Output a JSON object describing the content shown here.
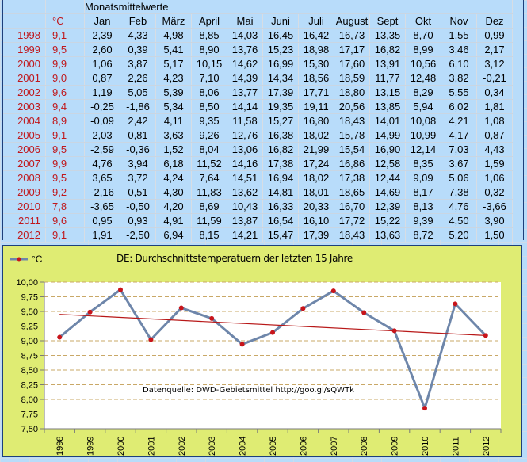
{
  "table": {
    "section_title": "Monatsmittelwerte",
    "headers": [
      "°C",
      "Jan",
      "Feb",
      "März",
      "April",
      "Mai",
      "Juni",
      "Juli",
      "August",
      "Sept",
      "Okt",
      "Nov",
      "Dez"
    ],
    "rows": [
      {
        "year": "1998",
        "avg": "9,1",
        "months": [
          "2,39",
          "4,33",
          "4,98",
          "8,85",
          "14,03",
          "16,45",
          "16,42",
          "16,73",
          "13,35",
          "8,70",
          "1,55",
          "0,99"
        ]
      },
      {
        "year": "1999",
        "avg": "9,5",
        "months": [
          "2,60",
          "0,39",
          "5,41",
          "8,90",
          "13,76",
          "15,23",
          "18,98",
          "17,17",
          "16,82",
          "8,99",
          "3,46",
          "2,17"
        ]
      },
      {
        "year": "2000",
        "avg": "9,9",
        "months": [
          "1,06",
          "3,87",
          "5,17",
          "10,15",
          "14,62",
          "16,99",
          "15,30",
          "17,60",
          "13,91",
          "10,56",
          "6,10",
          "3,12"
        ]
      },
      {
        "year": "2001",
        "avg": "9,0",
        "months": [
          "0,87",
          "2,26",
          "4,23",
          "7,10",
          "14,39",
          "14,34",
          "18,56",
          "18,59",
          "11,77",
          "12,48",
          "3,82",
          "-0,21"
        ]
      },
      {
        "year": "2002",
        "avg": "9,6",
        "months": [
          "1,19",
          "5,05",
          "5,39",
          "8,06",
          "13,77",
          "17,39",
          "17,71",
          "18,80",
          "13,15",
          "8,29",
          "5,55",
          "0,34"
        ]
      },
      {
        "year": "2003",
        "avg": "9,4",
        "months": [
          "-0,25",
          "-1,86",
          "5,34",
          "8,50",
          "14,14",
          "19,35",
          "19,11",
          "20,56",
          "13,85",
          "5,94",
          "6,02",
          "1,81"
        ]
      },
      {
        "year": "2004",
        "avg": "8,9",
        "months": [
          "-0,09",
          "2,42",
          "4,11",
          "9,35",
          "11,58",
          "15,27",
          "16,80",
          "18,43",
          "14,01",
          "10,08",
          "4,21",
          "1,08"
        ]
      },
      {
        "year": "2005",
        "avg": "9,1",
        "months": [
          "2,03",
          "0,81",
          "3,63",
          "9,26",
          "12,76",
          "16,38",
          "18,02",
          "15,78",
          "14,99",
          "10,99",
          "4,17",
          "0,87"
        ]
      },
      {
        "year": "2006",
        "avg": "9,5",
        "months": [
          "-2,59",
          "-0,36",
          "1,52",
          "8,04",
          "13,06",
          "16,82",
          "21,99",
          "15,54",
          "16,90",
          "12,14",
          "7,03",
          "4,43"
        ]
      },
      {
        "year": "2007",
        "avg": "9,9",
        "months": [
          "4,76",
          "3,94",
          "6,18",
          "11,52",
          "14,16",
          "17,38",
          "17,24",
          "16,86",
          "12,58",
          "8,35",
          "3,67",
          "1,59"
        ]
      },
      {
        "year": "2008",
        "avg": "9,5",
        "months": [
          "3,65",
          "3,72",
          "4,24",
          "7,64",
          "14,51",
          "16,94",
          "18,02",
          "17,38",
          "12,44",
          "9,09",
          "5,06",
          "1,06"
        ]
      },
      {
        "year": "2009",
        "avg": "9,2",
        "months": [
          "-2,16",
          "0,51",
          "4,30",
          "11,83",
          "13,62",
          "14,81",
          "18,01",
          "18,65",
          "14,69",
          "8,17",
          "7,38",
          "0,32"
        ]
      },
      {
        "year": "2010",
        "avg": "7,8",
        "months": [
          "-3,65",
          "-0,50",
          "4,20",
          "8,69",
          "10,43",
          "16,33",
          "20,33",
          "16,70",
          "12,39",
          "8,13",
          "4,76",
          "-3,66"
        ]
      },
      {
        "year": "2011",
        "avg": "9,6",
        "months": [
          "0,95",
          "0,93",
          "4,91",
          "11,59",
          "13,87",
          "16,54",
          "16,10",
          "17,72",
          "15,22",
          "9,39",
          "4,50",
          "3,90"
        ]
      },
      {
        "year": "2012",
        "avg": "9,1",
        "months": [
          "1,91",
          "-2,50",
          "6,94",
          "8,15",
          "14,21",
          "15,47",
          "17,39",
          "18,43",
          "13,63",
          "8,72",
          "5,20",
          "1,50"
        ]
      }
    ]
  },
  "colors": {
    "year_text": "#c0181c",
    "sheet_bg": "#b8dcfa",
    "chart_bg": "#dfec73",
    "plot_bg": "#ffffff",
    "series_line": "#6e86aa",
    "marker": "#c8141a",
    "trend": "#b81818",
    "grid": "#c9a867"
  },
  "chart_data": {
    "type": "line",
    "title": "DE: Durchschnittstemperatuern der letzten 15 Jahre",
    "annotation": "Datenquelle: DWD-Gebietsmittel  http://goo.gl/sQWTk",
    "legend": {
      "label": "°C",
      "placement": "top-left"
    },
    "xlabel": "",
    "ylabel": "",
    "x": [
      "1998",
      "1999",
      "2000",
      "2001",
      "2002",
      "2003",
      "2004",
      "2005",
      "2006",
      "2007",
      "2008",
      "2009",
      "2010",
      "2011",
      "2012"
    ],
    "series": [
      {
        "name": "°C",
        "values": [
          9.06,
          9.49,
          9.87,
          9.02,
          9.56,
          9.38,
          8.94,
          9.14,
          9.55,
          9.85,
          9.48,
          9.17,
          7.85,
          9.63,
          9.09
        ]
      }
    ],
    "trendline": {
      "type": "linear",
      "start": 9.45,
      "end": 9.09
    },
    "ylim": [
      7.5,
      10.0
    ],
    "yticks": [
      "10,00",
      "9,75",
      "9,50",
      "9,25",
      "9,00",
      "8,75",
      "8,50",
      "8,25",
      "8,00",
      "7,75",
      "7,50"
    ],
    "grid": true
  }
}
